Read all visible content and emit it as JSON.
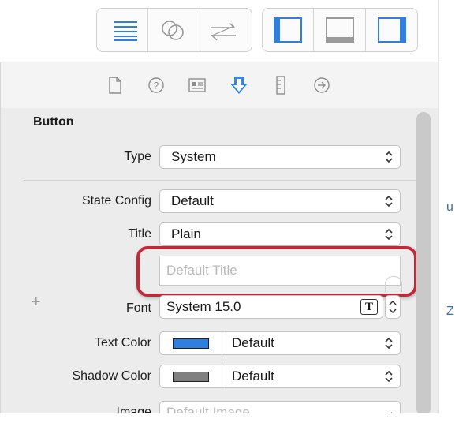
{
  "inspector": {
    "section_title": "Button",
    "type": {
      "label": "Type",
      "value": "System"
    },
    "state_config": {
      "label": "State Config",
      "value": "Default"
    },
    "title": {
      "label": "Title",
      "value": "Plain",
      "placeholder": "Default Title"
    },
    "font": {
      "add_symbol": "+",
      "label": "Font",
      "value": "System 15.0",
      "font_button_glyph": "T"
    },
    "text_color": {
      "label": "Text Color",
      "swatch_color": "#2f7fe0",
      "value": "Default"
    },
    "shadow_color": {
      "label": "Shadow Color",
      "swatch_color": "#808080",
      "value": "Default"
    },
    "image": {
      "label": "Image",
      "placeholder": "Default Image"
    }
  },
  "colors": {
    "highlight": "#c02b3c",
    "tab_active": "#2f86e5"
  },
  "side_glyphs": {
    "right_top": "u",
    "right_bottom": "Z"
  },
  "icons": {
    "toolbar": [
      "navigator-toggle-icon",
      "assistant-editor-icon",
      "version-editor-icon",
      "left-panel-icon",
      "bottom-panel-icon",
      "right-panel-icon"
    ],
    "tabs": [
      "file-inspector-icon",
      "quick-help-icon",
      "identity-inspector-icon",
      "attributes-inspector-icon",
      "size-inspector-icon",
      "connections-inspector-icon"
    ]
  }
}
